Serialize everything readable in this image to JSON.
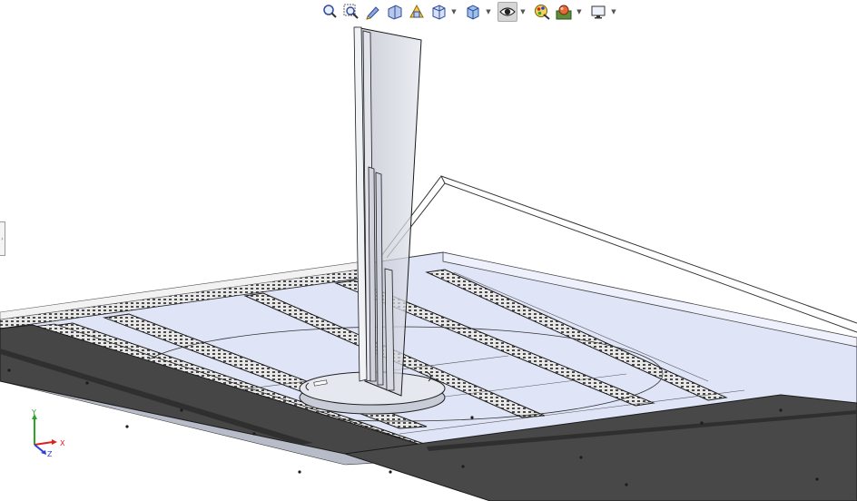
{
  "toolbar": {
    "buttons": [
      {
        "name": "zoom-to-fit",
        "icon": "zoom-to-fit-icon",
        "dropdown": false,
        "active": false
      },
      {
        "name": "zoom-to-area",
        "icon": "zoom-to-area-icon",
        "dropdown": false,
        "active": false
      },
      {
        "name": "previous-view",
        "icon": "previous-view-icon",
        "dropdown": false,
        "active": false
      },
      {
        "name": "section-view",
        "icon": "section-view-icon",
        "dropdown": false,
        "active": false
      },
      {
        "name": "dynamic-annotation-views",
        "icon": "dynamic-annotation-icon",
        "dropdown": false,
        "active": false
      },
      {
        "name": "view-orientation",
        "icon": "view-orientation-icon",
        "dropdown": true,
        "active": false
      },
      {
        "name": "display-style",
        "icon": "display-style-icon",
        "dropdown": true,
        "active": false
      },
      {
        "name": "hide-show-items",
        "icon": "eye-icon",
        "dropdown": true,
        "active": true
      },
      {
        "name": "edit-appearance",
        "icon": "edit-appearance-icon",
        "dropdown": false,
        "active": false
      },
      {
        "name": "apply-scene",
        "icon": "apply-scene-icon",
        "dropdown": true,
        "active": false
      },
      {
        "name": "view-settings",
        "icon": "monitor-icon",
        "dropdown": true,
        "active": false
      }
    ]
  },
  "triad": {
    "x_label": "X",
    "y_label": "Y",
    "z_label": "Z",
    "x_color": "#e0201c",
    "y_color": "#2aa52a",
    "z_color": "#2c3fd8"
  },
  "colors": {
    "background": "#ffffff",
    "plate_light": "#dfe4f7",
    "plate_dark": "#464646",
    "edge": "#202020",
    "glass": "#c8ccd8"
  }
}
